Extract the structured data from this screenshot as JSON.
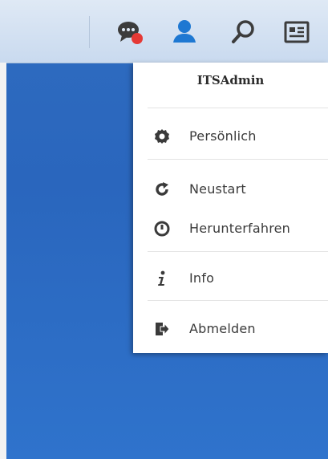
{
  "taskbar": {
    "icons": [
      "chat-notification-icon",
      "user-icon",
      "search-icon",
      "widgets-icon"
    ],
    "notification_color": "#e53935",
    "user_color": "#1e78d2"
  },
  "user_menu": {
    "username": "ITSAdmin",
    "items": [
      {
        "label": "Persönlich",
        "icon": "gear-icon"
      },
      {
        "label": "Neustart",
        "icon": "restart-icon"
      },
      {
        "label": "Herunterfahren",
        "icon": "power-icon"
      },
      {
        "label": "Info",
        "icon": "info-icon"
      },
      {
        "label": "Abmelden",
        "icon": "logout-icon"
      }
    ]
  }
}
